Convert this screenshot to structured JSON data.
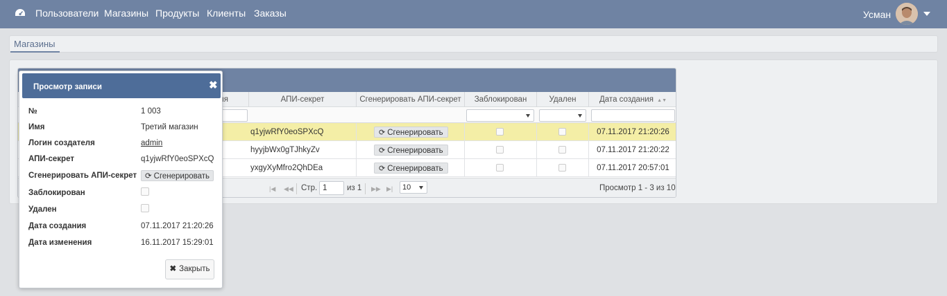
{
  "nav": {
    "items": [
      "Пользователи",
      "Магазины",
      "Продукты",
      "Клиенты",
      "Заказы"
    ],
    "user": "Усман"
  },
  "tabs": {
    "active": "Магазины"
  },
  "grid": {
    "columns": {
      "creator_partial": "еля",
      "api_secret": "АПИ-секрет",
      "generate": "Сгенерировать АПИ-секрет",
      "blocked": "Заблокирован",
      "deleted": "Удален",
      "created": "Дата создания"
    },
    "rows": [
      {
        "api_secret": "q1yjwRfY0eoSPXcQ",
        "generate": "Сгенерировать",
        "created": "07.11.2017 21:20:26"
      },
      {
        "api_secret": "hyyjbWx0gTJhkyZv",
        "generate": "Сгенерировать",
        "created": "07.11.2017 21:20:22"
      },
      {
        "api_secret": "yxgyXyMfro2QhDEa",
        "generate": "Сгенерировать",
        "created": "07.11.2017 20:57:01"
      }
    ],
    "pager": {
      "page_label": "Стр.",
      "page_value": "1",
      "of_label": "из 1",
      "per_page": "10",
      "summary": "Просмотр 1 - 3 из 10"
    }
  },
  "modal": {
    "title": "Просмотр записи",
    "fields": {
      "num_label": "№",
      "num_value": "1 003",
      "name_label": "Имя",
      "name_value": "Третий магазин",
      "login_label": "Логин создателя",
      "login_value": "admin",
      "api_label": "АПИ-секрет",
      "api_value": "q1yjwRfY0eoSPXcQ",
      "gen_label": "Сгенерировать АПИ-секрет",
      "gen_button": "Сгенерировать",
      "blocked_label": "Заблокирован",
      "deleted_label": "Удален",
      "created_label": "Дата создания",
      "created_value": "07.11.2017 21:20:26",
      "modified_label": "Дата изменения",
      "modified_value": "16.11.2017 15:29:01"
    },
    "close_button": "Закрыть"
  },
  "colors": {
    "navbar": "#6f83a3",
    "modal_header": "#4e6d99",
    "selected_row": "#f4eea6"
  }
}
